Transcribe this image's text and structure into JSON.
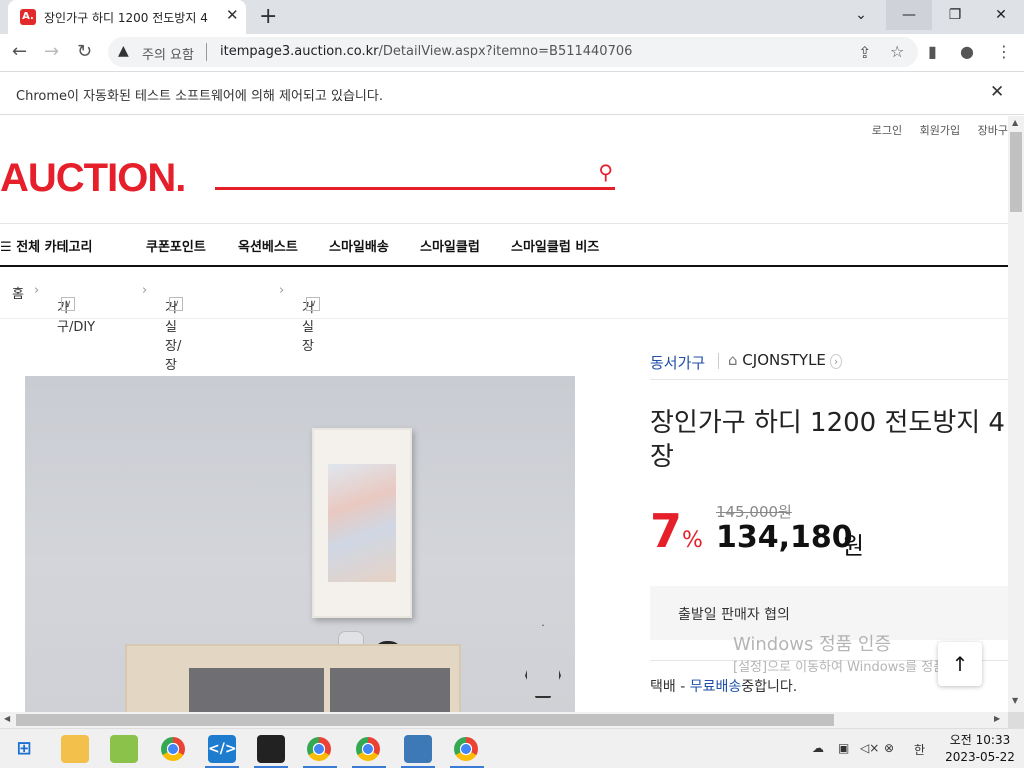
{
  "browser": {
    "tab_title": "장인가구 하디 1200 전도방지 4",
    "tab_favicon": "A.",
    "new_tab": "+",
    "security_label": "주의 요함",
    "url_domain": "itempage3.auction.co.kr",
    "url_path": "/DetailView.aspx?itemno=B511440706",
    "automation_message": "Chrome이 자동화된 테스트 소프트웨어에 의해 제어되고 있습니다."
  },
  "site": {
    "top_menu": [
      "로그인",
      "회원가입",
      "장바구"
    ],
    "logo": "AUCTION.",
    "all_categories": "전체 카테고리",
    "nav": [
      "쿠폰포인트",
      "옥션베스트",
      "스마일배송",
      "스마일클럽",
      "스마일클럽 비즈"
    ],
    "breadcrumb": [
      "홈",
      "가구/DIY",
      "거실장/장식장",
      "거실장"
    ]
  },
  "product": {
    "brand": "동서가구",
    "store": "CJONSTYLE",
    "title": "장인가구 하디 1200 전도방지 4\n장",
    "discount": "7",
    "discount_unit": "%",
    "original_price": "145,000원",
    "price": "134,180",
    "price_unit": "원",
    "ship_date": "출발일 판매자 협의",
    "delivery_prefix": "택배 - ",
    "delivery_free": "무료배송",
    "delivery_suffix": "중합니다."
  },
  "watermark": {
    "line1": "Windows 정품 인증",
    "line2": "[설정]으로 이동하여 Windows를 정품"
  },
  "taskbar": {
    "clock_time": "오전 10:33",
    "clock_date": "2023-05-22",
    "ime": "한"
  },
  "colors": {
    "brand_red": "#e5202b",
    "link_blue": "#1f4fa8"
  }
}
